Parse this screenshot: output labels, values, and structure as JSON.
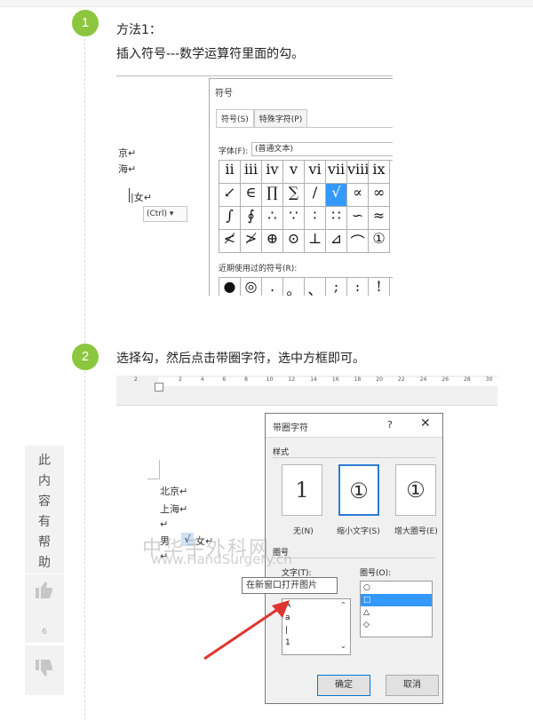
{
  "step1": {
    "number": "1",
    "line1": "方法1：",
    "line2": "插入符号---数学运算符里面的勾。",
    "doc_lines": [
      "京↵",
      "海↵",
      "|女↵"
    ],
    "paste_label": "(Ctrl) ▾",
    "dialog": {
      "title": "符号",
      "tabs": [
        "符号(S)",
        "特殊字符(P)"
      ],
      "font_label": "字体(F):",
      "font_value": "(普通文本)",
      "grid": [
        [
          "ii",
          "iii",
          "iv",
          "v",
          "vi",
          "vii",
          "viii",
          "ix"
        ],
        [
          "↙",
          "∈",
          "∏",
          "∑",
          "/",
          "√",
          "∝",
          "∞"
        ],
        [
          "∫",
          "∮",
          "∴",
          "∵",
          "∶",
          "∷",
          "∽",
          "≈"
        ],
        [
          "≮",
          "≯",
          "⊕",
          "⊙",
          "⊥",
          "⊿",
          "⌒",
          "①"
        ]
      ],
      "selected_symbol": "√",
      "recent_label": "近期使用过的符号(R):",
      "recent": [
        "●",
        "◎",
        ".",
        "。",
        "、",
        ";",
        ":",
        "!"
      ]
    }
  },
  "step2": {
    "number": "2",
    "text": "选择勾，然后点击带圈字符，选中方框即可。",
    "ruler_ticks": [
      "2",
      "2",
      "4",
      "6",
      "8",
      "10",
      "12",
      "14",
      "16",
      "18",
      "20",
      "22",
      "24",
      "26",
      "28",
      "30"
    ],
    "doc_lines": [
      "北京↵",
      "上海↵",
      "↵",
      "男",
      "女↵",
      "↵"
    ],
    "checkmark": "√",
    "dialog": {
      "title": "带圈字符",
      "help": "?",
      "close": "✕",
      "style_label": "样式",
      "styles": [
        {
          "glyph": "1",
          "label": "无(N)"
        },
        {
          "glyph": "①",
          "label": "缩小文字(S)"
        },
        {
          "glyph": "①",
          "label": "增大圈号(E)"
        }
      ],
      "enclosure_label": "圈号",
      "text_label": "文字(T):",
      "circle_label": "圈号(O):",
      "text_list": [
        "A",
        "a",
        "|",
        "1"
      ],
      "circle_list": [
        "○",
        "□",
        "△",
        "◇"
      ],
      "ok": "确定",
      "cancel": "取消"
    },
    "tooltip": "在新窗口打开图片"
  },
  "watermark": "中华手外科网",
  "watermark_url": "www.HandSurgery.cn",
  "feedback": {
    "question": [
      "此",
      "内",
      "容",
      "有",
      "帮",
      "助",
      "？"
    ],
    "upvote_icon": "thumbs-up",
    "upvote_count": "6",
    "downvote_icon": "thumbs-down"
  }
}
